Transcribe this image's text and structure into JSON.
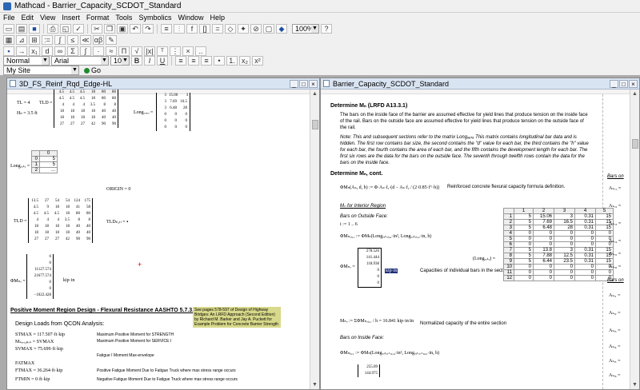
{
  "app": {
    "title": "Mathcad - Barrier_Capacity_SCDOT_Standard"
  },
  "menu": [
    "File",
    "Edit",
    "View",
    "Insert",
    "Format",
    "Tools",
    "Symbolics",
    "Window",
    "Help"
  ],
  "toolbar": {
    "zoom": "100%"
  },
  "format_bar": {
    "style": "Normal",
    "font": "Arial",
    "size": "10"
  },
  "resource_bar": {
    "site": "My Site",
    "go_label": "Go"
  },
  "left_window": {
    "title": "3D_FS_Reinf_Rqd_Edge-HL",
    "tl": "TL = 4",
    "hb": "Hₙ = 3.5 ft",
    "tld_label": "TLD =",
    "tld_top": [
      [
        "4.5",
        "4.5",
        "4.5",
        "18",
        "80",
        "80"
      ],
      [
        "4.5",
        "4.5",
        "4.5",
        "18",
        "80",
        "80"
      ],
      [
        "4",
        "4",
        "4",
        "3.5",
        "8",
        "8"
      ],
      [
        "18",
        "18",
        "18",
        "18",
        "40",
        "40"
      ],
      [
        "18",
        "18",
        "18",
        "18",
        "40",
        "40"
      ],
      [
        "27",
        "27",
        "27",
        "42",
        "90",
        "90"
      ]
    ],
    "long_label": "Long₇ₑₑₒ =",
    "long_vals": [
      [
        "3",
        "15.06",
        "3"
      ],
      [
        "3",
        "7.69",
        "16.5"
      ],
      [
        "3",
        "6.48",
        "28"
      ],
      [
        "0",
        "0",
        "0"
      ],
      [
        "0",
        "0",
        "0"
      ],
      [
        "0",
        "0",
        "0"
      ]
    ],
    "longdata_label": "Longₔₐₜₐ =",
    "longdata_header": "0",
    "longdata_rows": [
      [
        "0",
        "5"
      ],
      [
        "1",
        "5"
      ],
      [
        "2",
        "..."
      ]
    ],
    "origin": "ORIGIN = 0",
    "tld2_rows": [
      [
        "13.5",
        "27",
        "54",
        "54",
        "124",
        "175"
      ],
      [
        "4.5",
        "9",
        "18",
        "18",
        "41",
        "58"
      ],
      [
        "4.5",
        "4.5",
        "4.5",
        "18",
        "80",
        "80"
      ],
      [
        "4",
        "4",
        "4",
        "3.5",
        "8",
        "8"
      ],
      [
        "18",
        "18",
        "18",
        "18",
        "40",
        "40"
      ],
      [
        "18",
        "18",
        "18",
        "18",
        "40",
        "40"
      ],
      [
        "27",
        "27",
        "27",
        "42",
        "90",
        "90"
      ]
    ],
    "tld_tl": "TLDₜₗ,ₜₗ = ▪",
    "phim_label": "ΦMₙₒ =",
    "phim_vals": [
      "0",
      "0",
      "11127.574",
      "21677.574",
      "0",
      "0",
      "−1022.428"
    ],
    "phim_unit": "kip·in",
    "heading": "Positive Moment Region Design - Flexural Resistance AASHTO 5.7.3.2",
    "note": "See pages 578-597 of Design of Highway Bridges: An LRFD Approach (Second Edition) by Richard M. Barker and Jay A. Puckett for Example Problem for Concrete Barrier Strength",
    "loads_title": "Design Loads from QCON  Analysis:",
    "loads": [
      {
        "eq": "STMAX = 117.507·ft·kip",
        "desc": "Maximum Positive Moment for STRENGTH"
      },
      {
        "eq": "Mₛₑᵣᵥ,ₚₒₛ = SVMAX",
        "desc": "Maximum Positive Moment for SERVICE I"
      },
      {
        "eq": "SVMAX = 75.699·ft·kip",
        "desc": ""
      },
      {
        "eq": "",
        "desc": "Fatigue I Moment Max-envelope"
      },
      {
        "eq": "FATMAX",
        "desc": ""
      },
      {
        "eq": "FTMAX = 36.264·ft·kip",
        "desc": "Positive Fatigue Moment Due to Fatigue Truck where max stress range occurs"
      },
      {
        "eq": "FTMIN = 0·ft·kip",
        "desc": "Negative Fatigue Moment Due to Fatigue Truck where max stress range occurs"
      }
    ]
  },
  "right_window": {
    "title": "Barrier_Capacity_SCDOT_Standard",
    "h1": "Determine Mₙ (LRFD A13.3.1)",
    "p1": "The bars on the inside face of the barrier are assumed effective for yield lines that produce tension on the inside face of the rail. Bars on the outside face are assumed effective for yield lines that produce tension on the outside face of the rail.",
    "p2": "Note: This and subsequent sections refer to the matrix Longₔₐₜₐ This matrix contains longitudinal bar data and is hidden. The first row contains bar size, the second contains the \"d\" value for each bar, the third contains the \"h\" value for each bar, the fourth contains the area of each bar, and the fifth contains the development length for each bar. The first six rows are the data for the bars on the outside face. The seventh through twelfth rows contain the data for the bars on the inside face.",
    "h2": "Determine Mₙ, cont.",
    "func": "ΦMₙ(Aₛ, d, b) := Φ·Aₛ·fᵧ·(d − Aₛ·fᵧ / (2·0.85·f'ᶜ·b))",
    "func_desc": "Reinforced concrete flexural capacity formula definition.",
    "mw_interior": "Mₙ for Interior Region",
    "bars_outside": "Bars on Outside Face:",
    "i_range": "i := 1 .. 6",
    "phimno_eq": "ΦMₙₒᵢ,₁ := ΦMₙ(Longₔₐₜₐᵢ,₄·in², Longₔₐₜₐᵢ,₂·in, h)",
    "phimno_label": "ΦMₙₒ =",
    "phimno_vals": [
      "278.526",
      "141.444",
      "118.938",
      "0",
      "0",
      "0"
    ],
    "phimno_unit": "kip·in",
    "capacities_desc": "Capacities of individual bars in the section",
    "longdata_label": "(Longₔₐₜₐ) =",
    "table_header": [
      "",
      "1",
      "2",
      "3",
      "4",
      "5"
    ],
    "table_rows": [
      [
        "1",
        "5",
        "15.06",
        "3",
        "0.31",
        "15"
      ],
      [
        "2",
        "5",
        "7.69",
        "16.5",
        "0.31",
        "15"
      ],
      [
        "3",
        "5",
        "6.48",
        "28",
        "0.31",
        "15"
      ],
      [
        "4",
        "0",
        "0",
        "0",
        "0",
        "0"
      ],
      [
        "5",
        "0",
        "0",
        "0",
        "0",
        "0"
      ],
      [
        "6",
        "0",
        "0",
        "0",
        "0",
        "0"
      ],
      [
        "7",
        "5",
        "13.8",
        "3",
        "0.31",
        "15"
      ],
      [
        "8",
        "5",
        "7.88",
        "12.5",
        "0.31",
        "15"
      ],
      [
        "9",
        "5",
        "6.44",
        "23.5",
        "0.31",
        "15"
      ],
      [
        "10",
        "0",
        "0",
        "0",
        "0",
        "0"
      ],
      [
        "11",
        "0",
        "0",
        "0",
        "0",
        "0"
      ],
      [
        "12",
        "0",
        "0",
        "0",
        "0",
        "0"
      ]
    ],
    "mwo_eq": "Mₙₒ := ΣΦMₙₒᵢ,₁ / h = 16.841 kip·in/in",
    "mwo_desc": "Normalized capacity of the entire section",
    "bars_inside": "Bars on Inside Face:",
    "phimi_eq": "ΦMₙᵢᵢ,₁ := ΦMₙ(Longₔₐₜₐᵢ₊₆,₄·in², Longₔₐₜₐᵢ₊₆,₂·in, h)",
    "phimi_vals": [
      "255.09",
      "144.975"
    ],
    "side_labels": [
      "Bars on",
      "Aₛₒ₁ =",
      "Aₛₒ₂ =",
      "Aₛₒ₃ =",
      "Aₛₒ₄ =",
      "Aₛₒ₅ =",
      "Aₛₒ₆ =",
      "Bars on",
      "Aₛᵢ₁ =",
      "Aₛᵢ₂ =",
      "Aₛᵢ₃ =",
      "Aₛᵢ₄ =",
      "Aₛᵢ₅ =",
      "Aₛᵢ₆ ="
    ]
  }
}
